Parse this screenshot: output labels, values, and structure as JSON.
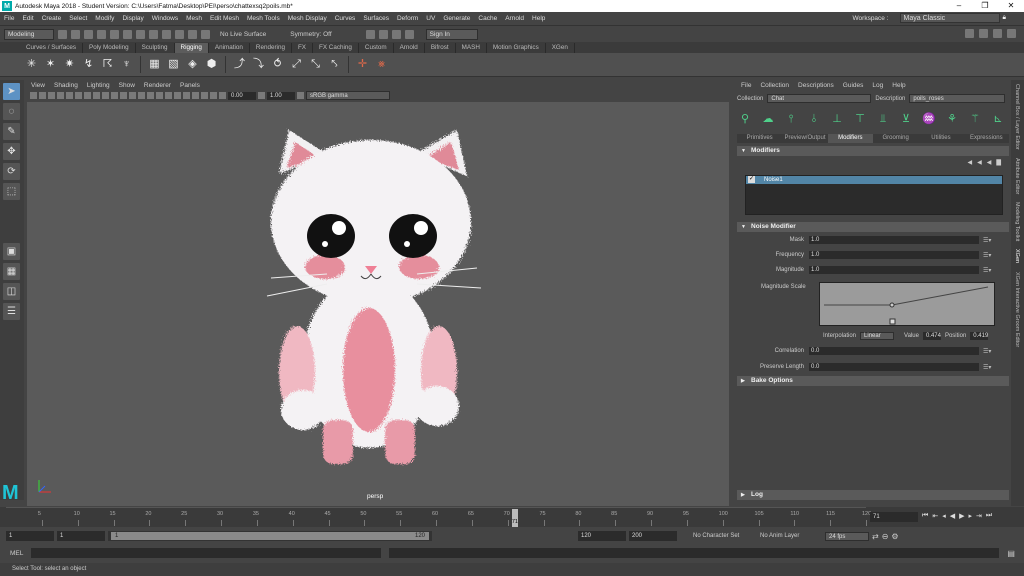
{
  "window": {
    "title": "Autodesk Maya 2018 - Student Version: C:\\Users\\Fatma\\Desktop\\PEI\\perso\\chattexsq2poils.mb*"
  },
  "menus": [
    "File",
    "Edit",
    "Create",
    "Select",
    "Modify",
    "Display",
    "Windows",
    "Mesh",
    "Edit Mesh",
    "Mesh Tools",
    "Mesh Display",
    "Curves",
    "Surfaces",
    "Deform",
    "UV",
    "Generate",
    "Cache",
    "Arnold",
    "Help"
  ],
  "workspace": {
    "label": "Workspace :",
    "value": "Maya Classic"
  },
  "status": {
    "mode": "Modeling",
    "live_surface": "No Live Surface",
    "symmetry": "Symmetry: Off",
    "sign_in": "Sign In"
  },
  "shelf_tabs": [
    "Curves / Surfaces",
    "Poly Modeling",
    "Sculpting",
    "Rigging",
    "Animation",
    "Rendering",
    "FX",
    "FX Caching",
    "Custom",
    "Arnold",
    "Bifrost",
    "MASH",
    "Motion Graphics",
    "XGen"
  ],
  "active_shelf": "Rigging",
  "panel_menus": [
    "View",
    "Shading",
    "Lighting",
    "Show",
    "Renderer",
    "Panels"
  ],
  "panel_toolbar": {
    "exposure": "0.00",
    "gamma": "1.00",
    "color_space": "sRGB gamma"
  },
  "viewport": {
    "camera": "persp"
  },
  "xgen": {
    "menus": [
      "File",
      "Collection",
      "Descriptions",
      "Guides",
      "Log",
      "Help"
    ],
    "collection_label": "Collection",
    "collection": "Chat",
    "description_label": "Description",
    "description": "poils_roses",
    "tabs": [
      "Primitives",
      "Preview/Output",
      "Modifiers",
      "Grooming",
      "Utilities",
      "Expressions"
    ],
    "active_tab": "Modifiers",
    "modifiers_header": "Modifiers",
    "modifier_item": "Noise1",
    "noise_header": "Noise Modifier",
    "attrs": [
      {
        "label": "Mask",
        "value": "1.0"
      },
      {
        "label": "Frequency",
        "value": "1.0"
      },
      {
        "label": "Magnitude",
        "value": "1.0"
      }
    ],
    "magnitude_scale_label": "Magnitude Scale",
    "interp_label": "Interpolation",
    "interp": "Linear",
    "value_label": "Value",
    "value": "0.474",
    "position_label": "Position",
    "position": "0.419",
    "attrs2": [
      {
        "label": "Correlation",
        "value": "0.0"
      },
      {
        "label": "Preserve Length",
        "value": "0.0"
      }
    ],
    "bake_header": "Bake Options",
    "log_header": "Log"
  },
  "right_tabs": [
    "Channel Box / Layer Editor",
    "Attribute Editor",
    "Modeling Toolkit",
    "XGen",
    "XGen Interactive Groom Editor"
  ],
  "timeline": {
    "ticks": [
      "5",
      "10",
      "15",
      "20",
      "25",
      "30",
      "35",
      "40",
      "45",
      "50",
      "55",
      "60",
      "65",
      "70",
      "75",
      "80",
      "85",
      "90",
      "95",
      "100",
      "105",
      "110",
      "115",
      "120"
    ],
    "current": "71",
    "current_field": "71"
  },
  "range": {
    "start": "1",
    "start2": "1",
    "inner_start": "1",
    "inner_end": "120",
    "end": "120",
    "end2": "200",
    "char_set": "No Character Set",
    "anim_layer": "No Anim Layer",
    "fps": "24 fps"
  },
  "cmd": {
    "label": "MEL"
  },
  "help": "Select Tool: select an object"
}
